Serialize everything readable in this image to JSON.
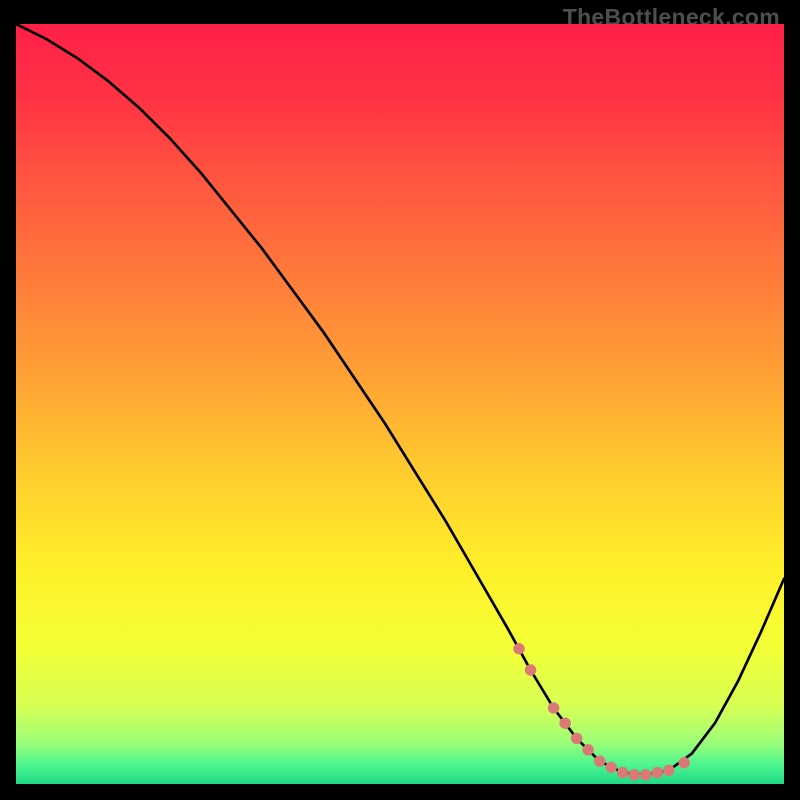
{
  "watermark": "TheBottleneck.com",
  "chart_data": {
    "type": "line",
    "title": "",
    "xlabel": "",
    "ylabel": "",
    "xlim": [
      0,
      100
    ],
    "ylim": [
      0,
      100
    ],
    "grid": false,
    "legend": false,
    "series": [
      {
        "name": "bottleneck-curve",
        "x": [
          0,
          4,
          8,
          12,
          16,
          20,
          24,
          28,
          32,
          36,
          40,
          44,
          48,
          52,
          56,
          60,
          64,
          67,
          70,
          73,
          76,
          79,
          82,
          85,
          88,
          91,
          94,
          97,
          100
        ],
        "y": [
          100,
          98,
          95.5,
          92.5,
          89,
          85,
          80.5,
          75.5,
          70.5,
          65,
          59.5,
          53.5,
          47.5,
          41,
          34.5,
          27.5,
          20.5,
          15,
          10,
          6,
          3,
          1.5,
          1.2,
          1.8,
          4,
          8,
          13.5,
          20,
          27
        ]
      }
    ],
    "markers": {
      "name": "highlight-dots",
      "color": "#d97a77",
      "x": [
        65.5,
        67,
        70,
        71.5,
        73,
        74.5,
        76,
        77.5,
        79,
        80.5,
        82,
        83.5,
        85,
        87
      ],
      "y": [
        17.8,
        15,
        10,
        8,
        6,
        4.5,
        3,
        2.2,
        1.5,
        1.2,
        1.2,
        1.5,
        1.8,
        2.8
      ]
    },
    "gradient_stops": [
      {
        "offset": 0.0,
        "color": "#ff1f47"
      },
      {
        "offset": 0.1,
        "color": "#ff3344"
      },
      {
        "offset": 0.22,
        "color": "#ff5a3f"
      },
      {
        "offset": 0.35,
        "color": "#ff7f3a"
      },
      {
        "offset": 0.48,
        "color": "#ffa734"
      },
      {
        "offset": 0.6,
        "color": "#ffcf2e"
      },
      {
        "offset": 0.72,
        "color": "#fff02a"
      },
      {
        "offset": 0.82,
        "color": "#f4ff36"
      },
      {
        "offset": 0.9,
        "color": "#d4ff55"
      },
      {
        "offset": 0.945,
        "color": "#9dff78"
      },
      {
        "offset": 0.975,
        "color": "#4cf58e"
      },
      {
        "offset": 1.0,
        "color": "#1fd885"
      }
    ]
  }
}
